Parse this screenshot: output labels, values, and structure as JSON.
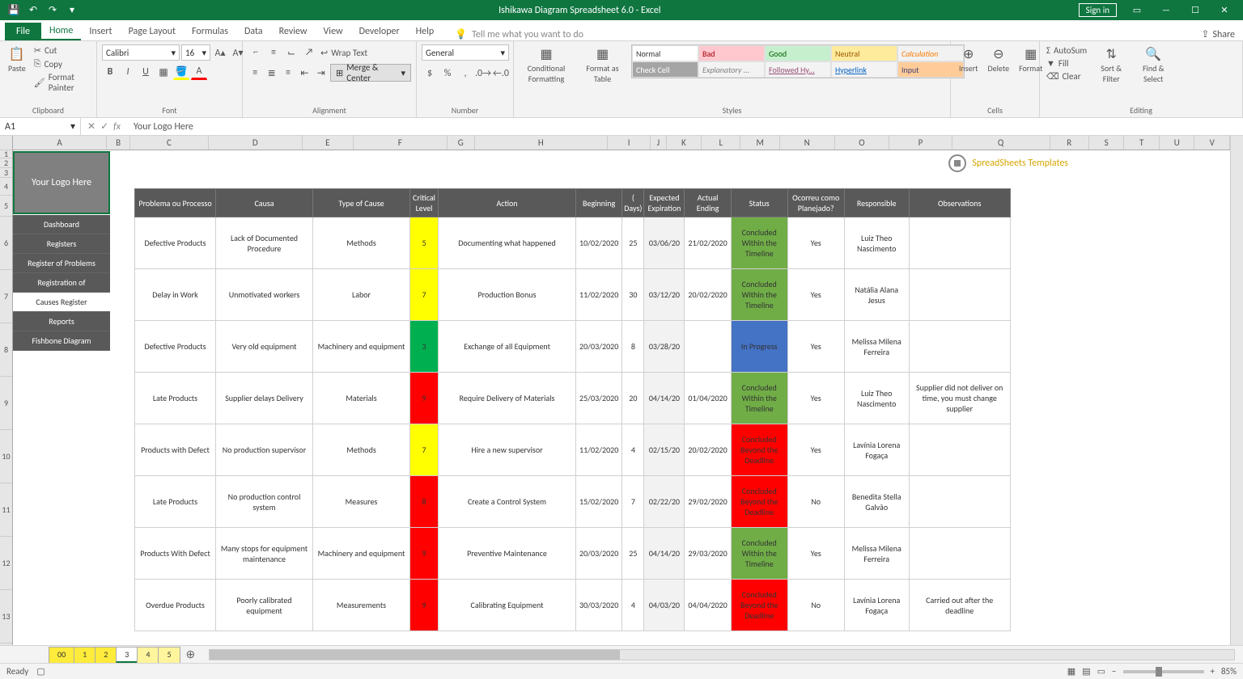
{
  "titlebar": {
    "title": "Ishikawa Diagram Spreadsheet 6.0  -  Excel",
    "signin": "Sign in"
  },
  "tabs": {
    "file": "File",
    "home": "Home",
    "insert": "Insert",
    "pagelayout": "Page Layout",
    "formulas": "Formulas",
    "data": "Data",
    "review": "Review",
    "view": "View",
    "developer": "Developer",
    "help": "Help",
    "tellme": "Tell me what you want to do",
    "share": "Share"
  },
  "ribbon": {
    "clipboard": {
      "label": "Clipboard",
      "paste": "Paste",
      "cut": "Cut",
      "copy": "Copy",
      "painter": "Format Painter"
    },
    "font": {
      "label": "Font",
      "name": "Calibri",
      "size": "16"
    },
    "alignment": {
      "label": "Alignment",
      "wrap": "Wrap Text",
      "merge": "Merge & Center"
    },
    "number": {
      "label": "Number",
      "format": "General"
    },
    "styles": {
      "label": "Styles",
      "cond": "Conditional Formatting",
      "table": "Format as Table",
      "normal": "Normal",
      "bad": "Bad",
      "good": "Good",
      "neutral": "Neutral",
      "calc": "Calculation",
      "check": "Check Cell",
      "explan": "Explanatory ...",
      "hyper": "Followed Hy...",
      "link": "Hyperlink",
      "input": "Input"
    },
    "cells": {
      "label": "Cells",
      "insert": "Insert",
      "delete": "Delete",
      "format": "Format"
    },
    "editing": {
      "label": "Editing",
      "autosum": "AutoSum",
      "fill": "Fill",
      "clear": "Clear",
      "sort": "Sort & Filter",
      "find": "Find & Select"
    }
  },
  "namebox": "A1",
  "formula": "Your Logo Here",
  "cols": [
    "A",
    "B",
    "C",
    "D",
    "E",
    "F",
    "G",
    "H",
    "I",
    "J",
    "K",
    "L",
    "M",
    "N",
    "O",
    "P",
    "Q",
    "R",
    "S",
    "T",
    "U",
    "V"
  ],
  "logo": "Your Logo Here",
  "nav": [
    "Dashboard",
    "Registers",
    "Register of Problems",
    "Registration of",
    "Causes Register",
    "Reports",
    "Fishbone Diagram"
  ],
  "brand": "SpreadSheets Templates",
  "headers": {
    "h1": "Problema ou Processo",
    "h2": "Causa",
    "h3": "Type of Cause",
    "h4": "Critical Level",
    "h5": "Action",
    "h6": "Beginning",
    "h7": "( Days)",
    "h8": "Expected Expiration",
    "h9": "Actual Ending",
    "h10": "Status",
    "h11": "Ocorreu como Planejado?",
    "h12": "Responsible",
    "h13": "Observations"
  },
  "rows": [
    {
      "p": "Defective Products",
      "c": "Lack of Documented Procedure",
      "t": "Methods",
      "lv": "5",
      "lvc": "crit-5",
      "a": "Documenting what happened",
      "b": "10/02/2020",
      "d": "25",
      "e": "03/06/20",
      "ae": "21/02/2020",
      "s": "Concluded Within the Timeline",
      "sc": "stat-on",
      "pl": "Yes",
      "r": "Luiz Theo Nascimento",
      "o": ""
    },
    {
      "p": "Delay in Work",
      "c": "Unmotivated workers",
      "t": "Labor",
      "lv": "7",
      "lvc": "crit-7",
      "a": "Production Bonus",
      "b": "11/02/2020",
      "d": "30",
      "e": "03/12/20",
      "ae": "20/02/2020",
      "s": "Concluded Within the Timeline",
      "sc": "stat-on",
      "pl": "Yes",
      "r": "Natália Alana Jesus",
      "o": ""
    },
    {
      "p": "Defective Products",
      "c": "Very old equipment",
      "t": "Machinery and equipment",
      "lv": "3",
      "lvc": "crit-3",
      "a": "Exchange of all Equipment",
      "b": "20/03/2020",
      "d": "8",
      "e": "03/28/20",
      "ae": "",
      "s": "In Progress",
      "sc": "stat-prog",
      "pl": "Yes",
      "r": "Melissa Milena Ferreira",
      "o": ""
    },
    {
      "p": "Late Products",
      "c": "Supplier delays Delivery",
      "t": "Materials",
      "lv": "9",
      "lvc": "crit-9",
      "a": "Require Delivery of Materials",
      "b": "25/03/2020",
      "d": "20",
      "e": "04/14/20",
      "ae": "01/04/2020",
      "s": "Concluded Within the Timeline",
      "sc": "stat-on",
      "pl": "Yes",
      "r": "Luiz Theo Nascimento",
      "o": "Supplier did not deliver on time, you must change supplier"
    },
    {
      "p": "Products with Defect",
      "c": "No production supervisor",
      "t": "Methods",
      "lv": "7",
      "lvc": "crit-7",
      "a": "Hire a new supervisor",
      "b": "11/02/2020",
      "d": "4",
      "e": "02/15/20",
      "ae": "20/02/2020",
      "s": "Concluded Beyond the Deadline",
      "sc": "stat-late",
      "pl": "Yes",
      "r": "Lavínia Lorena Fogaça",
      "o": ""
    },
    {
      "p": "Late Products",
      "c": "No production control system",
      "t": "Measures",
      "lv": "8",
      "lvc": "crit-8",
      "a": "Create a Control System",
      "b": "15/02/2020",
      "d": "7",
      "e": "02/22/20",
      "ae": "29/02/2020",
      "s": "Concluded Beyond the Deadline",
      "sc": "stat-late",
      "pl": "No",
      "r": "Benedita Stella Galvão",
      "o": ""
    },
    {
      "p": "Products With Defect",
      "c": "Many stops for equipment maintenance",
      "t": "Machinery and equipment",
      "lv": "9",
      "lvc": "crit-9",
      "a": "Preventive Maintenance",
      "b": "20/03/2020",
      "d": "25",
      "e": "04/14/20",
      "ae": "29/03/2020",
      "s": "Concluded Within the Timeline",
      "sc": "stat-on",
      "pl": "Yes",
      "r": "Melissa Milena Ferreira",
      "o": ""
    },
    {
      "p": "Overdue Products",
      "c": "Poorly calibrated equipment",
      "t": "Measurements",
      "lv": "9",
      "lvc": "crit-9",
      "a": "Calibrating Equipment",
      "b": "30/03/2020",
      "d": "4",
      "e": "04/03/20",
      "ae": "04/04/2020",
      "s": "Concluded Beyond the Deadline",
      "sc": "stat-late",
      "pl": "No",
      "r": "Lavínia Lorena Fogaça",
      "o": "Carried out after the deadline"
    }
  ],
  "sheettabs": [
    "00",
    "1",
    "2",
    "3",
    "4",
    "5"
  ],
  "status": {
    "ready": "Ready",
    "zoom": "85%"
  }
}
